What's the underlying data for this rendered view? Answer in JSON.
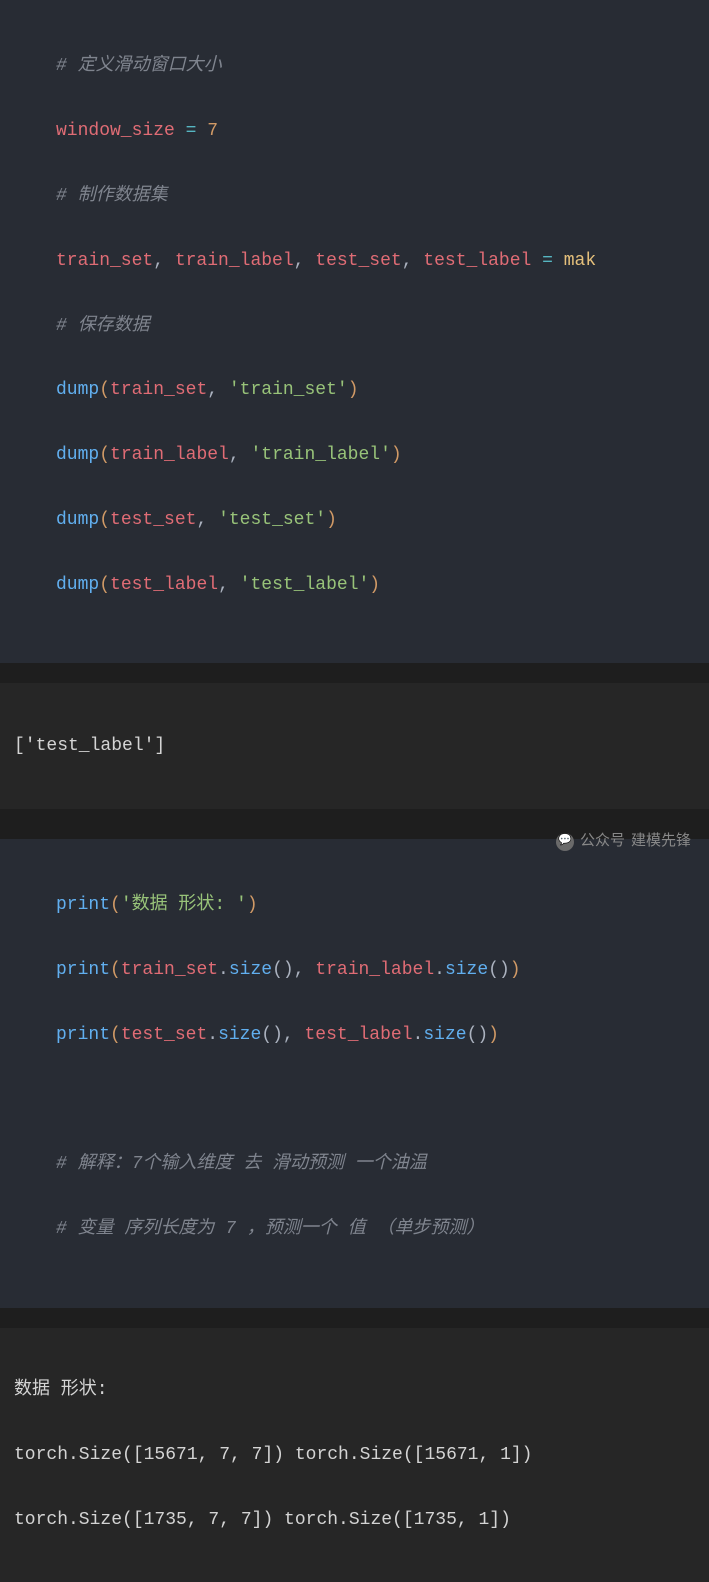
{
  "block1": {
    "c1": "# 定义滑动窗口大小",
    "l2_var": "window_size",
    "l2_eq": " = ",
    "l2_val": "7",
    "c2": "# 制作数据集",
    "l4_a": "train_set",
    "l4_s1": ", ",
    "l4_b": "train_label",
    "l4_s2": ", ",
    "l4_c": "test_set",
    "l4_s3": ", ",
    "l4_d": "test_label",
    "l4_eq": " = ",
    "l4_fn": "mak",
    "c3": "# 保存数据",
    "d1_fn": "dump",
    "d1_p1": "(",
    "d1_a": "train_set",
    "d1_s": ", ",
    "d1_str": "'train_set'",
    "d1_p2": ")",
    "d2_fn": "dump",
    "d2_p1": "(",
    "d2_a": "train_label",
    "d2_s": ", ",
    "d2_str": "'train_label'",
    "d2_p2": ")",
    "d3_fn": "dump",
    "d3_p1": "(",
    "d3_a": "test_set",
    "d3_s": ", ",
    "d3_str": "'test_set'",
    "d3_p2": ")",
    "d4_fn": "dump",
    "d4_p1": "(",
    "d4_a": "test_label",
    "d4_s": ", ",
    "d4_str": "'test_label'",
    "d4_p2": ")"
  },
  "output1": "['test_label']",
  "block2": {
    "p1_fn": "print",
    "p1_p1": "(",
    "p1_str": "'数据 形状: '",
    "p1_p2": ")",
    "p2_fn": "print",
    "p2_p1": "(",
    "p2_a": "train_set",
    "p2_dot1": ".",
    "p2_m1": "size",
    "p2_pp1": "()",
    "p2_s": ", ",
    "p2_b": "train_label",
    "p2_dot2": ".",
    "p2_m2": "size",
    "p2_pp2": "()",
    "p2_p2": ")",
    "p3_fn": "print",
    "p3_p1": "(",
    "p3_a": "test_set",
    "p3_dot1": ".",
    "p3_m1": "size",
    "p3_pp1": "()",
    "p3_s": ", ",
    "p3_b": "test_label",
    "p3_dot2": ".",
    "p3_m2": "size",
    "p3_pp2": "()",
    "p3_p2": ")",
    "c1": "# 解释：7个输入维度 去 滑动预测 一个油温",
    "c2": "# 变量 序列长度为 7 ，预测一个 值 （单步预测）"
  },
  "output2": {
    "l1": "数据 形状:",
    "l2": "torch.Size([15671, 7, 7]) torch.Size([15671, 1])",
    "l3": "torch.Size([1735, 7, 7]) torch.Size([1735, 1])"
  },
  "watermark": {
    "label": "公众号",
    "name": "建模先锋"
  }
}
